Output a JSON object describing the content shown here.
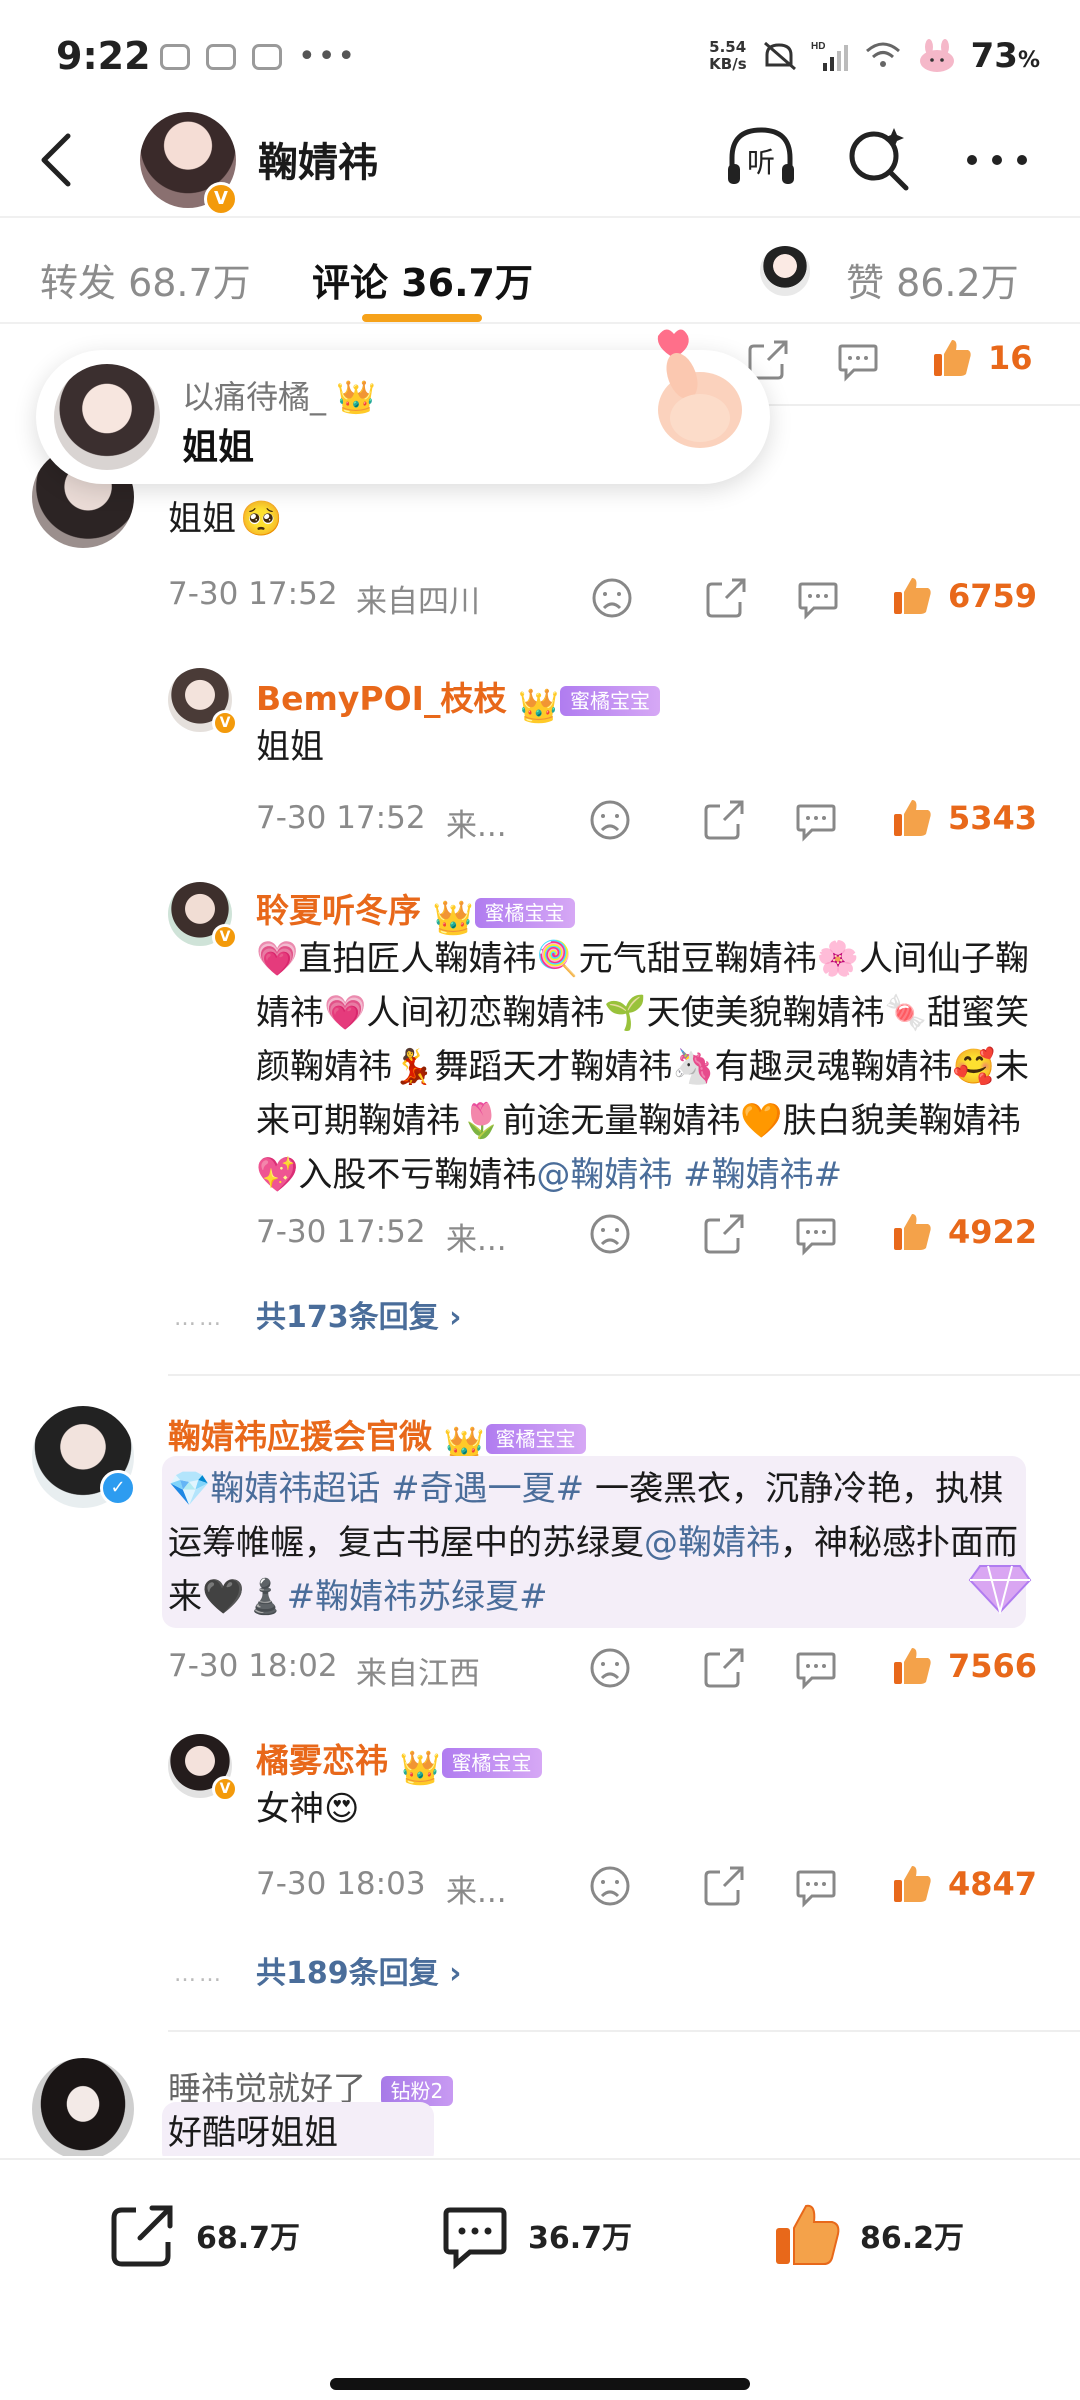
{
  "status_bar": {
    "time": "9:22",
    "net_speed_value": "5.54",
    "net_speed_unit": "KB/s",
    "hd_label": "HD",
    "battery": "73",
    "battery_unit": "%"
  },
  "header": {
    "title": "鞠婧祎",
    "listen_label": "听"
  },
  "tabs": {
    "repost": "转发 68.7万",
    "comments": "评论 36.7万",
    "likes": "赞 86.2万"
  },
  "popup": {
    "user": "以痛待橘_",
    "text": "姐姐"
  },
  "comments": [
    {
      "text": "姐姐",
      "time": "7-30 17:52",
      "location": "来自四川",
      "likes": "6759",
      "replies": [
        {
          "user": "BemyPOI_枝枝",
          "badge": "蜜橘宝宝",
          "text": "姐姐",
          "time": "7-30 17:52",
          "location": "来...",
          "likes": "5343"
        },
        {
          "user": "聆夏听冬序",
          "badge": "蜜橘宝宝",
          "text": "💗直拍匠人鞠婧祎🍭元气甜豆鞠婧祎🌸人间仙子鞠婧祎💗人间初恋鞠婧祎🌱天使美貌鞠婧祎🍬甜蜜笑颜鞠婧祎💃舞蹈天才鞠婧祎🦄有趣灵魂鞠婧祎🥰未来可期鞠婧祎🌷前途无量鞠婧祎🧡肤白貌美鞠婧祎💖入股不亏鞠婧祎",
          "mention": "@鞠婧祎",
          "hashtag": "#鞠婧祎#",
          "time": "7-30 17:52",
          "location": "来...",
          "likes": "4922"
        }
      ],
      "more_replies": "共173条回复"
    },
    {
      "user": "鞠婧祎应援会官微",
      "badge": "蜜橘宝宝",
      "supertopic": "💎鞠婧祎超话",
      "tag1": "#奇遇一夏#",
      "text1": " 一袭黑衣，沉静冷艳，执棋运筹帷幄，复古书屋中的苏绿夏",
      "mention": "@鞠婧祎",
      "text2": "，神秘感扑面而来🖤♟️",
      "tag2": "#鞠婧祎苏绿夏#",
      "time": "7-30 18:02",
      "location": "来自江西",
      "likes": "7566",
      "replies": [
        {
          "user": "橘雾恋祎",
          "badge": "蜜橘宝宝",
          "text": "女神😍",
          "time": "7-30 18:03",
          "location": "来...",
          "likes": "4847"
        }
      ],
      "more_replies": "共189条回复"
    },
    {
      "user": "睡祎觉就好了",
      "badge": "钻粉2",
      "text": "好酷呀姐姐"
    }
  ],
  "top_row": {
    "likes": "16"
  },
  "bottom_bar": {
    "repost": "68.7万",
    "comment": "36.7万",
    "like": "86.2万"
  },
  "colors": {
    "accent_orange": "#e8681a",
    "tab_underline": "#f6a21a",
    "link_blue": "#4a6d9a",
    "badge_purple": "#b07cf0"
  }
}
